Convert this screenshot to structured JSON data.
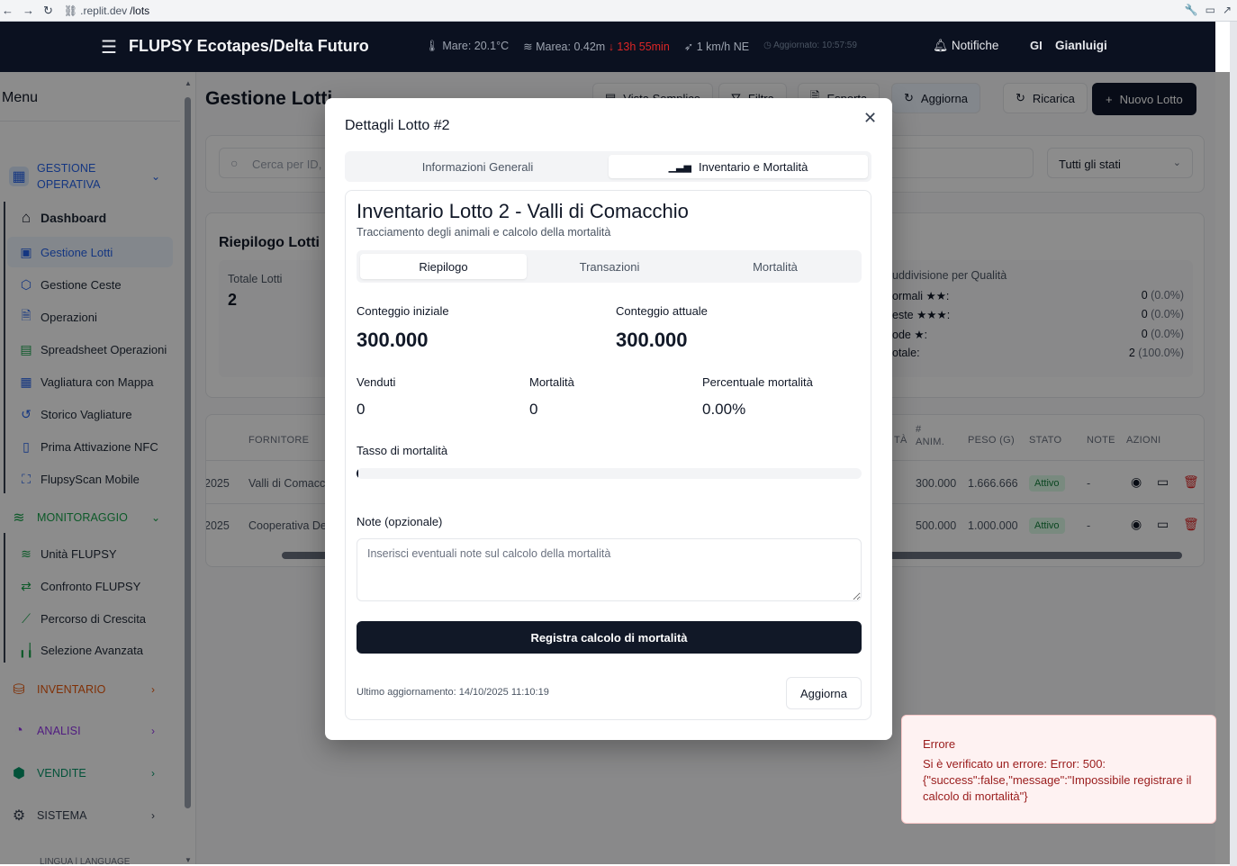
{
  "browser": {
    "back": "←",
    "forward": "→",
    "reload": "↻",
    "url_prefix": ".replit.dev",
    "url_path": "/lots"
  },
  "header": {
    "title": "FLUPSY Ecotapes/Delta Futuro",
    "sea_temp": "Mare: 20.1°C",
    "tide": "Marea: 0.42m",
    "tide_change": "↓ 13h 55min",
    "wind": "1 km/h NE",
    "updated": "Aggiornato: 10:57:59",
    "notifications": "Notifiche",
    "user_initials": "GI",
    "user_name": "Gianluigi"
  },
  "sidebar": {
    "menu_title": "Menu",
    "groups": {
      "operativa": {
        "line1": "GESTIONE",
        "line2": "OPERATIVA",
        "color": "#2563eb"
      },
      "monitoraggio": {
        "label": "MONITORAGGIO",
        "color": "#16a34a"
      },
      "inventario": {
        "label": "INVENTARIO",
        "color": "#ea580c"
      },
      "analisi": {
        "label": "ANALISI",
        "color": "#9333ea"
      },
      "vendite": {
        "label": "VENDITE",
        "color": "#059669"
      },
      "sistema": {
        "label": "SISTEMA",
        "color": "#374151"
      }
    },
    "items": [
      {
        "label": "Dashboard",
        "icon": "home-icon"
      },
      {
        "label": "Gestione Lotti",
        "icon": "package-icon"
      },
      {
        "label": "Gestione Ceste",
        "icon": "box-icon"
      },
      {
        "label": "Operazioni",
        "icon": "file-icon"
      },
      {
        "label": "Spreadsheet Operazioni",
        "icon": "table-icon"
      },
      {
        "label": "Vagliatura con Mappa",
        "icon": "grid-icon"
      },
      {
        "label": "Storico Vagliature",
        "icon": "history-icon"
      },
      {
        "label": "Prima Attivazione NFC",
        "icon": "phone-icon"
      },
      {
        "label": "FlupsyScan Mobile",
        "icon": "scan-icon"
      }
    ],
    "monitor_items": [
      {
        "label": "Unità FLUPSY",
        "icon": "waves-icon"
      },
      {
        "label": "Confronto FLUPSY",
        "icon": "compare-icon"
      },
      {
        "label": "Percorso di Crescita",
        "icon": "chart-line-icon"
      },
      {
        "label": "Selezione Avanzata",
        "icon": "bar-chart-icon"
      }
    ],
    "language": "LINGUA | LANGUAGE"
  },
  "page": {
    "title": "Gestione Lotti",
    "toolbar": {
      "simple_view": "Vista Semplice",
      "filter": "Filtra",
      "export": "Esporta",
      "update": "Aggiorna",
      "reload": "Ricarica",
      "new_lot": "Nuovo Lotto"
    },
    "search_placeholder": "Cerca per ID, fo",
    "status_filter": "Tutti gli stati",
    "summary": {
      "title": "Riepilogo Lotti",
      "total_label": "Totale Lotti",
      "total_value": "2",
      "quality_title": "uddivisione per Qualità",
      "quality": [
        {
          "label": "ormali ★★:",
          "value": "0",
          "pct": "(0.0%)"
        },
        {
          "label": "este ★★★:",
          "value": "0",
          "pct": "(0.0%)"
        },
        {
          "label": "ode ★:",
          "value": "0",
          "pct": "(0.0%)"
        },
        {
          "label": "otale:",
          "value": "2",
          "pct": "(100.0%)"
        }
      ]
    },
    "table": {
      "headers": {
        "supplier": "FORNITORE",
        "qty_trunc": "TÀ",
        "animals_1": "#",
        "animals_2": "ANIM.",
        "weight": "PESO (G)",
        "status": "STATO",
        "notes": "NOTE",
        "actions": "AZIONI"
      },
      "rows": [
        {
          "date": "2025",
          "supplier": "Valli di Comacc",
          "animals": "300.000",
          "weight": "1.666.666",
          "status": "Attivo",
          "notes": "-"
        },
        {
          "date": "2025",
          "supplier": "Cooperativa De",
          "animals": "500.000",
          "weight": "1.000.000",
          "status": "Attivo",
          "notes": "-"
        }
      ]
    }
  },
  "modal": {
    "title": "Dettagli Lotto #2",
    "tabs": [
      "Informazioni Generali",
      "Inventario e Mortalità"
    ],
    "inventory": {
      "title": "Inventario Lotto 2 - Valli di Comacchio",
      "subtitle": "Tracciamento degli animali e calcolo della mortalità",
      "tabs": [
        "Riepilogo",
        "Transazioni",
        "Mortalità"
      ],
      "initial_label": "Conteggio iniziale",
      "initial_value": "300.000",
      "current_label": "Conteggio attuale",
      "current_value": "300.000",
      "sold_label": "Venduti",
      "sold_value": "0",
      "mortality_label": "Mortalità",
      "mortality_value": "0",
      "mortality_pct_label": "Percentuale mortalità",
      "mortality_pct_value": "0.00%",
      "rate_label": "Tasso di mortalità",
      "rate_fraction": 0.0,
      "notes_label": "Note (opzionale)",
      "notes_placeholder": "Inserisci eventuali note sul calcolo della mortalità",
      "submit": "Registra calcolo di mortalità",
      "last_update": "Ultimo aggiornamento: 14/10/2025 11:10:19",
      "refresh": "Aggiorna"
    }
  },
  "toast": {
    "title": "Errore",
    "message": "Si è verificato un errore: Error: 500: {\"success\":false,\"message\":\"Impossibile registrare il calcolo di mortalità\"}"
  }
}
